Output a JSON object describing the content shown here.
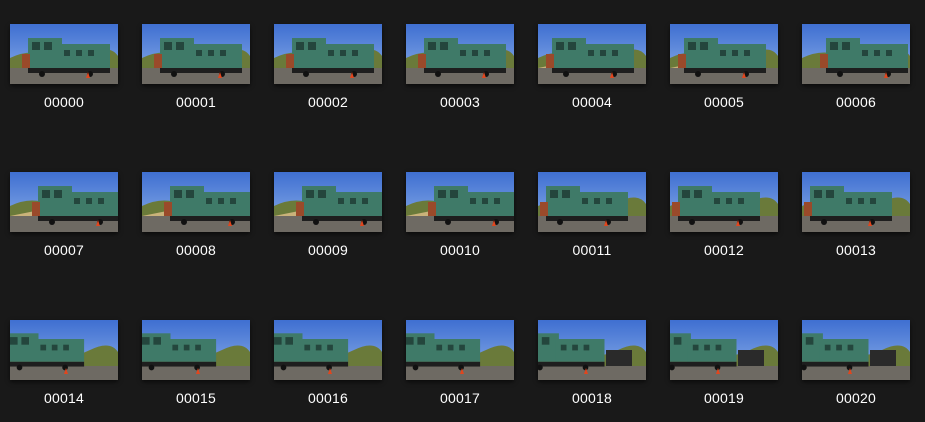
{
  "window": {
    "title": "",
    "background": "#191919"
  },
  "thumbnails": [
    {
      "label": "00000",
      "variant": 0
    },
    {
      "label": "00001",
      "variant": 0
    },
    {
      "label": "00002",
      "variant": 0
    },
    {
      "label": "00003",
      "variant": 1
    },
    {
      "label": "00004",
      "variant": 2
    },
    {
      "label": "00005",
      "variant": 2
    },
    {
      "label": "00006",
      "variant": 3
    },
    {
      "label": "00007",
      "variant": 4
    },
    {
      "label": "00008",
      "variant": 4
    },
    {
      "label": "00009",
      "variant": 4
    },
    {
      "label": "00010",
      "variant": 4
    },
    {
      "label": "00011",
      "variant": 5
    },
    {
      "label": "00012",
      "variant": 5
    },
    {
      "label": "00013",
      "variant": 5
    },
    {
      "label": "00014",
      "variant": 6
    },
    {
      "label": "00015",
      "variant": 6
    },
    {
      "label": "00016",
      "variant": 6
    },
    {
      "label": "00017",
      "variant": 6
    },
    {
      "label": "00018",
      "variant": 7
    },
    {
      "label": "00019",
      "variant": 7
    },
    {
      "label": "00020",
      "variant": 7
    }
  ],
  "colors": {
    "sky": "#3f6fd1",
    "sky_light": "#8fb2ea",
    "hill": "#6a7a3a",
    "ground": "#6e6a63",
    "loco_green": "#3f7a68",
    "loco_dark": "#24463d",
    "rust": "#9a4a2a",
    "cone": "#e0461e",
    "label_text": "#ffffff"
  },
  "icon": "photo-thumbnail-icon"
}
